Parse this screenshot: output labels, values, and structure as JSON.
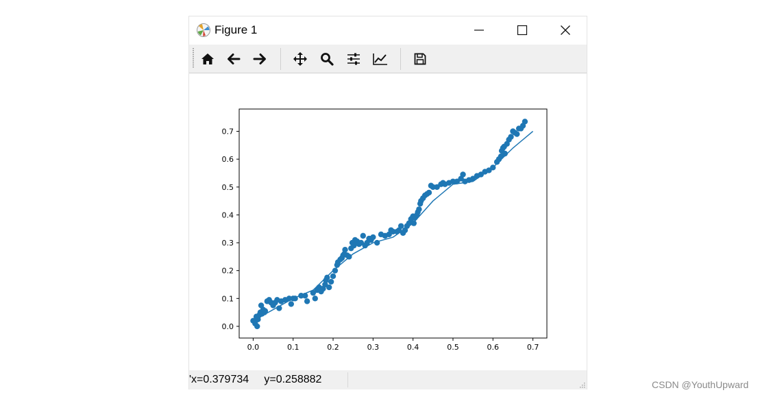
{
  "window": {
    "title": "Figure 1",
    "icons": {
      "app": "matplotlib-icon",
      "minimize": "minimize-icon",
      "maximize": "maximize-icon",
      "close": "close-icon"
    }
  },
  "toolbar": {
    "buttons": [
      {
        "name": "home-button",
        "icon": "home-icon"
      },
      {
        "name": "back-button",
        "icon": "arrow-left-icon"
      },
      {
        "name": "forward-button",
        "icon": "arrow-right-icon"
      },
      {
        "name": "pan-button",
        "icon": "move-icon"
      },
      {
        "name": "zoom-button",
        "icon": "magnifier-icon"
      },
      {
        "name": "subplots-button",
        "icon": "sliders-icon"
      },
      {
        "name": "edit-axis-button",
        "icon": "line-chart-icon"
      },
      {
        "name": "save-button",
        "icon": "floppy-disk-icon"
      }
    ]
  },
  "statusbar": {
    "coords": "'x=0.379734     y=0.258882"
  },
  "watermark": "CSDN @YouthUpward",
  "colors": {
    "series": "#1f77b4",
    "toolbar_bg": "#f0f0f0",
    "statusbar_bg": "#f0f0f0"
  },
  "chart_data": {
    "type": "scatter",
    "title": "",
    "xlabel": "",
    "ylabel": "",
    "xlim": [
      -0.035,
      0.735
    ],
    "ylim": [
      -0.042,
      0.78
    ],
    "xticks": [
      0.0,
      0.1,
      0.2,
      0.3,
      0.4,
      0.5,
      0.6,
      0.7
    ],
    "xtick_labels": [
      "0.0",
      "0.1",
      "0.2",
      "0.3",
      "0.4",
      "0.5",
      "0.6",
      "0.7"
    ],
    "yticks": [
      0.0,
      0.1,
      0.2,
      0.3,
      0.4,
      0.5,
      0.6,
      0.7
    ],
    "ytick_labels": [
      "0.0",
      "0.1",
      "0.2",
      "0.3",
      "0.4",
      "0.5",
      "0.6",
      "0.7"
    ],
    "grid": false,
    "series": [
      {
        "kind": "scatter",
        "color": "#1f77b4",
        "points": [
          [
            0.0,
            0.02
          ],
          [
            0.005,
            0.01
          ],
          [
            0.008,
            0.035
          ],
          [
            0.01,
            0.0
          ],
          [
            0.012,
            0.025
          ],
          [
            0.015,
            0.04
          ],
          [
            0.018,
            0.05
          ],
          [
            0.02,
            0.075
          ],
          [
            0.022,
            0.045
          ],
          [
            0.025,
            0.06
          ],
          [
            0.028,
            0.05
          ],
          [
            0.03,
            0.055
          ],
          [
            0.035,
            0.09
          ],
          [
            0.04,
            0.095
          ],
          [
            0.045,
            0.085
          ],
          [
            0.05,
            0.075
          ],
          [
            0.055,
            0.085
          ],
          [
            0.06,
            0.095
          ],
          [
            0.065,
            0.065
          ],
          [
            0.07,
            0.09
          ],
          [
            0.08,
            0.095
          ],
          [
            0.09,
            0.1
          ],
          [
            0.095,
            0.08
          ],
          [
            0.1,
            0.1
          ],
          [
            0.105,
            0.1
          ],
          [
            0.12,
            0.11
          ],
          [
            0.13,
            0.11
          ],
          [
            0.135,
            0.09
          ],
          [
            0.15,
            0.12
          ],
          [
            0.155,
            0.1
          ],
          [
            0.16,
            0.13
          ],
          [
            0.165,
            0.14
          ],
          [
            0.17,
            0.125
          ],
          [
            0.175,
            0.135
          ],
          [
            0.18,
            0.15
          ],
          [
            0.182,
            0.165
          ],
          [
            0.185,
            0.175
          ],
          [
            0.19,
            0.14
          ],
          [
            0.195,
            0.16
          ],
          [
            0.2,
            0.18
          ],
          [
            0.205,
            0.2
          ],
          [
            0.21,
            0.22
          ],
          [
            0.212,
            0.23
          ],
          [
            0.218,
            0.24
          ],
          [
            0.222,
            0.245
          ],
          [
            0.225,
            0.255
          ],
          [
            0.228,
            0.26
          ],
          [
            0.23,
            0.275
          ],
          [
            0.235,
            0.255
          ],
          [
            0.24,
            0.25
          ],
          [
            0.245,
            0.28
          ],
          [
            0.248,
            0.3
          ],
          [
            0.252,
            0.29
          ],
          [
            0.255,
            0.31
          ],
          [
            0.26,
            0.305
          ],
          [
            0.265,
            0.295
          ],
          [
            0.27,
            0.3
          ],
          [
            0.275,
            0.325
          ],
          [
            0.28,
            0.29
          ],
          [
            0.285,
            0.3
          ],
          [
            0.29,
            0.315
          ],
          [
            0.295,
            0.31
          ],
          [
            0.3,
            0.32
          ],
          [
            0.31,
            0.3
          ],
          [
            0.32,
            0.33
          ],
          [
            0.33,
            0.325
          ],
          [
            0.34,
            0.33
          ],
          [
            0.345,
            0.345
          ],
          [
            0.35,
            0.34
          ],
          [
            0.36,
            0.34
          ],
          [
            0.365,
            0.345
          ],
          [
            0.37,
            0.36
          ],
          [
            0.375,
            0.335
          ],
          [
            0.38,
            0.345
          ],
          [
            0.385,
            0.36
          ],
          [
            0.39,
            0.37
          ],
          [
            0.395,
            0.385
          ],
          [
            0.4,
            0.395
          ],
          [
            0.402,
            0.37
          ],
          [
            0.405,
            0.39
          ],
          [
            0.41,
            0.4
          ],
          [
            0.412,
            0.41
          ],
          [
            0.415,
            0.42
          ],
          [
            0.418,
            0.44
          ],
          [
            0.42,
            0.45
          ],
          [
            0.425,
            0.46
          ],
          [
            0.43,
            0.47
          ],
          [
            0.435,
            0.475
          ],
          [
            0.44,
            0.48
          ],
          [
            0.445,
            0.505
          ],
          [
            0.45,
            0.5
          ],
          [
            0.46,
            0.5
          ],
          [
            0.47,
            0.51
          ],
          [
            0.475,
            0.515
          ],
          [
            0.48,
            0.51
          ],
          [
            0.49,
            0.515
          ],
          [
            0.5,
            0.52
          ],
          [
            0.51,
            0.52
          ],
          [
            0.52,
            0.53
          ],
          [
            0.525,
            0.545
          ],
          [
            0.53,
            0.52
          ],
          [
            0.54,
            0.525
          ],
          [
            0.55,
            0.53
          ],
          [
            0.56,
            0.54
          ],
          [
            0.57,
            0.545
          ],
          [
            0.58,
            0.555
          ],
          [
            0.59,
            0.56
          ],
          [
            0.6,
            0.57
          ],
          [
            0.61,
            0.59
          ],
          [
            0.615,
            0.6
          ],
          [
            0.62,
            0.61
          ],
          [
            0.622,
            0.63
          ],
          [
            0.625,
            0.64
          ],
          [
            0.628,
            0.645
          ],
          [
            0.63,
            0.62
          ],
          [
            0.635,
            0.655
          ],
          [
            0.64,
            0.67
          ],
          [
            0.645,
            0.68
          ],
          [
            0.65,
            0.7
          ],
          [
            0.655,
            0.695
          ],
          [
            0.66,
            0.69
          ],
          [
            0.665,
            0.71
          ],
          [
            0.67,
            0.71
          ],
          [
            0.675,
            0.72
          ],
          [
            0.68,
            0.735
          ]
        ]
      },
      {
        "kind": "line",
        "color": "#1f77b4",
        "x": [
          0.0,
          0.1,
          0.15,
          0.2,
          0.25,
          0.3,
          0.35,
          0.4,
          0.45,
          0.5,
          0.55,
          0.6,
          0.65,
          0.7
        ],
        "y": [
          0.02,
          0.1,
          0.13,
          0.2,
          0.26,
          0.3,
          0.32,
          0.37,
          0.45,
          0.51,
          0.52,
          0.57,
          0.64,
          0.7
        ]
      }
    ]
  }
}
